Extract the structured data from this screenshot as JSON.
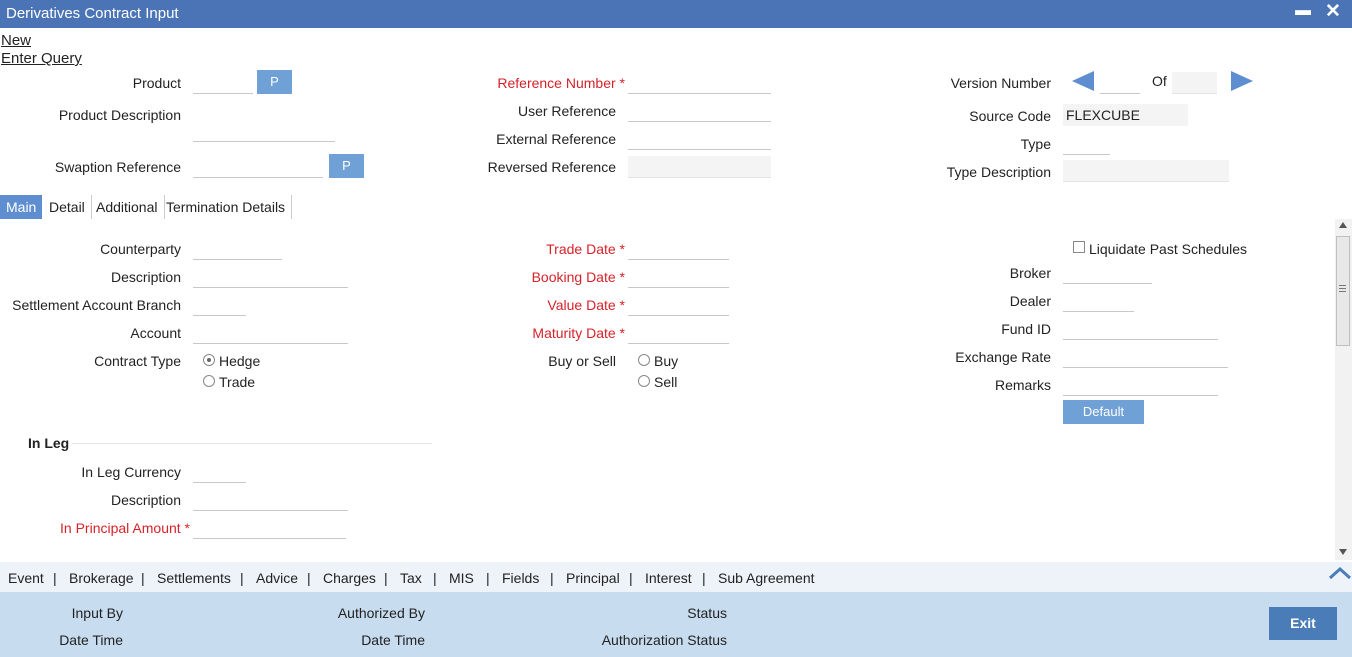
{
  "window": {
    "title": "Derivatives Contract Input",
    "minimize": "▬",
    "close": "✕"
  },
  "menu": {
    "new": "New",
    "enter_query": "Enter Query"
  },
  "header": {
    "product_label": "Product",
    "product_value": "",
    "p_button": "P",
    "product_description_label": "Product Description",
    "swaption_reference_label": "Swaption Reference",
    "reference_number_label": "Reference Number",
    "user_reference_label": "User Reference",
    "external_reference_label": "External Reference",
    "reversed_reference_label": "Reversed Reference",
    "version_number_label": "Version Number",
    "of_label": "Of",
    "source_code_label": "Source Code",
    "source_code_value": "FLEXCUBE",
    "type_label": "Type",
    "type_description_label": "Type Description",
    "required_mark": "*"
  },
  "tabs": [
    {
      "label": "Main",
      "active": true
    },
    {
      "label": "Detail",
      "active": false
    },
    {
      "label": "Additional",
      "active": false
    },
    {
      "label": "Termination Details",
      "active": false
    }
  ],
  "main": {
    "counterparty_label": "Counterparty",
    "description_label": "Description",
    "settlement_account_branch_label": "Settlement Account Branch",
    "account_label": "Account",
    "contract_type_label": "Contract Type",
    "contract_type_options": [
      "Hedge",
      "Trade"
    ],
    "contract_type_selected": "Hedge",
    "trade_date_label": "Trade Date",
    "booking_date_label": "Booking Date",
    "value_date_label": "Value Date",
    "maturity_date_label": "Maturity Date",
    "buy_or_sell_label": "Buy or Sell",
    "buy_or_sell_options": [
      "Buy",
      "Sell"
    ],
    "liquidate_past_schedules_label": "Liquidate Past Schedules",
    "broker_label": "Broker",
    "dealer_label": "Dealer",
    "fund_id_label": "Fund ID",
    "exchange_rate_label": "Exchange Rate",
    "remarks_label": "Remarks",
    "default_button": "Default",
    "in_leg_title": "In Leg",
    "in_leg_currency_label": "In Leg Currency",
    "in_leg_description_label": "Description",
    "in_principal_amount_label": "In Principal Amount"
  },
  "toolbar": [
    "Event",
    "Brokerage",
    "Settlements",
    "Advice",
    "Charges",
    "Tax",
    "MIS",
    "Fields",
    "Principal",
    "Interest",
    "Sub Agreement"
  ],
  "toolbar_separator": "|",
  "footer": {
    "input_by": "Input By",
    "date_time_1": "Date Time",
    "authorized_by": "Authorized By",
    "date_time_2": "Date Time",
    "status": "Status",
    "authorization_status": "Authorization Status",
    "exit": "Exit"
  },
  "colors": {
    "titlebar": "#4a74b6",
    "button": "#6fa0d6",
    "required": "#d7222a",
    "footer": "#c7dcef"
  }
}
